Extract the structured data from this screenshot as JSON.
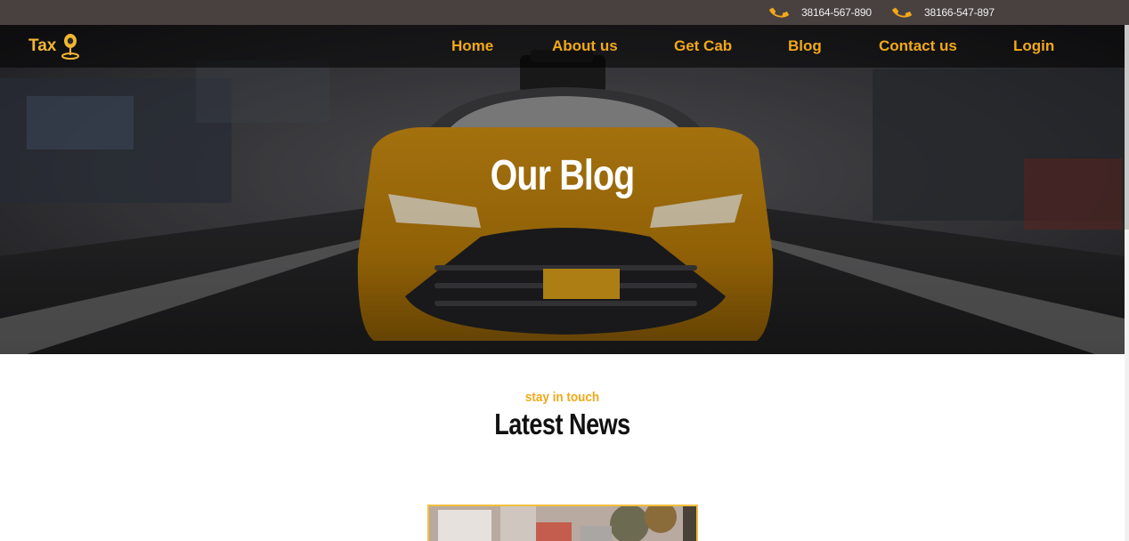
{
  "topbar": {
    "phones": [
      {
        "icon": "phone-icon",
        "number": "38164-567-890"
      },
      {
        "icon": "phone-icon",
        "number": "38166-547-897"
      }
    ]
  },
  "nav": {
    "logo_text": "Tax",
    "logo_icon": "map-pin-icon",
    "items": [
      "Home",
      "About us",
      "Get Cab",
      "Blog",
      "Contact us",
      "Login"
    ]
  },
  "hero": {
    "title": "Our Blog"
  },
  "section": {
    "subtitle": "stay in touch",
    "title": "Latest News"
  },
  "colors": {
    "accent": "#f2a818",
    "topbar": "#48413f",
    "white": "#ffffff"
  }
}
